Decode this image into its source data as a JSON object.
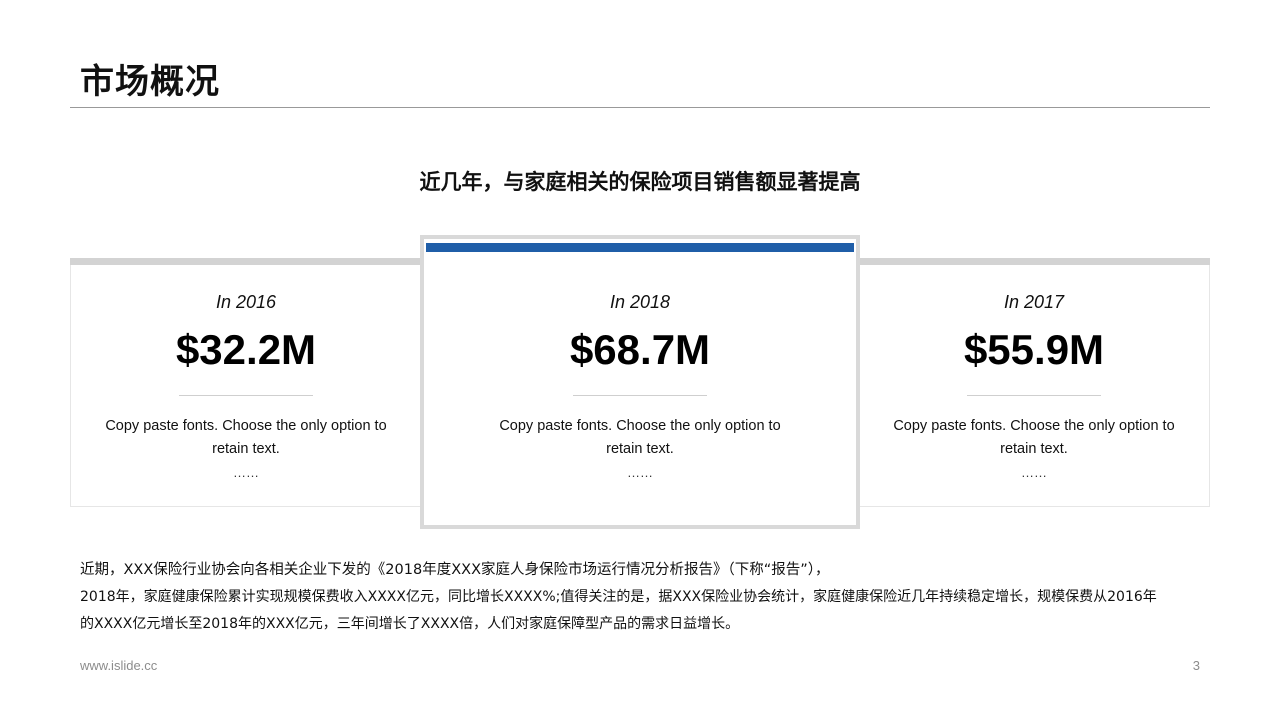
{
  "slide": {
    "title": "市场概况",
    "subtitle": "近几年，与家庭相关的保险项目销售额显著提高"
  },
  "cards": {
    "left": {
      "year": "In 2016",
      "amount": "$32.2M",
      "desc_line1": "Copy paste fonts. Choose the only option to",
      "desc_line2": "retain text.",
      "ellipsis": "……"
    },
    "center": {
      "year": "In 2018",
      "amount": "$68.7M",
      "desc_line1": "Copy paste fonts. Choose the only option to",
      "desc_line2": "retain text.",
      "ellipsis": "……"
    },
    "right": {
      "year": "In 2017",
      "amount": "$55.9M",
      "desc_line1": "Copy paste fonts. Choose the only option to",
      "desc_line2": "retain text.",
      "ellipsis": "……"
    }
  },
  "paragraph": {
    "line1": "近期，XXX保险行业协会向各相关企业下发的《2018年度XXX家庭人身保险市场运行情况分析报告》（下称“报告”），",
    "line2": "2018年，家庭健康保险累计实现规模保费收入XXXX亿元，同比增长XXXX%;值得关注的是，据XXX保险业协会统计，家庭健康保险近几年持续稳定增长，规模保费从2016年",
    "line3": "的XXXX亿元增长至2018年的XXX亿元，三年间增长了XXXX倍，人们对家庭保障型产品的需求日益增长。"
  },
  "footer": {
    "url": "www.islide.cc",
    "page_number": "3"
  },
  "colors": {
    "accent": "#1f5ea8",
    "side_bar": "#d3d3d3",
    "center_border": "#d9d9d9",
    "footer_text": "#8c8c8c"
  }
}
